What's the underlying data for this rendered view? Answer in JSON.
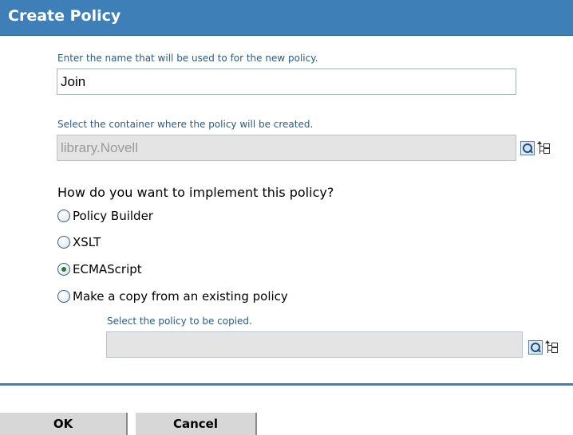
{
  "header": {
    "title": "Create Policy"
  },
  "name_section": {
    "hint": "Enter the name that will be used to for the new policy.",
    "value": "Join"
  },
  "container_section": {
    "hint": "Select the container where the policy will be created.",
    "value": "library.Novell"
  },
  "implementation": {
    "question": "How do you want to implement this policy?",
    "options": [
      {
        "label": "Policy Builder",
        "checked": false
      },
      {
        "label": "XSLT",
        "checked": false
      },
      {
        "label": "ECMAScript",
        "checked": true
      },
      {
        "label": "Make a copy from an existing policy",
        "checked": false
      }
    ]
  },
  "copy_section": {
    "hint": "Select the policy to be copied.",
    "value": ""
  },
  "footer": {
    "ok_label": "OK",
    "cancel_label": "Cancel"
  },
  "icons": {
    "search": "search-icon",
    "browse": "tree-browse-icon"
  },
  "colors": {
    "titlebar": "#3e7fb8",
    "hint_text": "#2a5a8c",
    "selected_radio": "#2c7a2c"
  }
}
